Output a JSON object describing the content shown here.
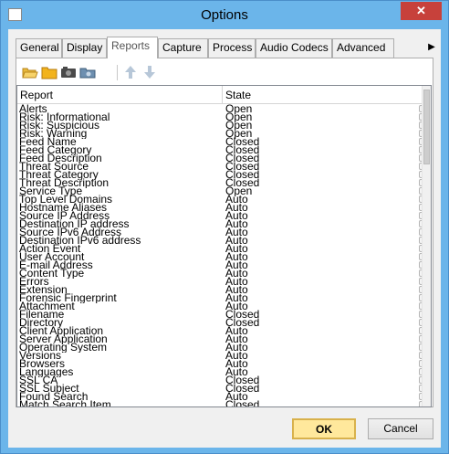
{
  "window": {
    "title": "Options",
    "close_label": "✕"
  },
  "tabs": [
    {
      "label": "General"
    },
    {
      "label": "Display"
    },
    {
      "label": "Reports"
    },
    {
      "label": "Capture"
    },
    {
      "label": "Process"
    },
    {
      "label": "Audio Codecs"
    },
    {
      "label": "Advanced"
    }
  ],
  "tab_scroll_icon": "▶",
  "toolbar": {
    "buttons": [
      "open-folder-icon",
      "folder-icon",
      "camera-icon",
      "camera-folder-icon",
      "arrow-up-icon",
      "arrow-down-icon"
    ]
  },
  "list": {
    "columns": [
      "Report",
      "State"
    ],
    "rows": [
      [
        "Alerts",
        "Open"
      ],
      [
        "Risk: Informational",
        "Open"
      ],
      [
        "Risk: Suspicious",
        "Open"
      ],
      [
        "Risk: Warning",
        "Open"
      ],
      [
        "Feed Name",
        "Closed"
      ],
      [
        "Feed Category",
        "Closed"
      ],
      [
        "Feed Description",
        "Closed"
      ],
      [
        "Threat Source",
        "Closed"
      ],
      [
        "Threat Category",
        "Closed"
      ],
      [
        "Threat Description",
        "Closed"
      ],
      [
        "Service Type",
        "Open"
      ],
      [
        "Top Level Domains",
        "Auto"
      ],
      [
        "Hostname Aliases",
        "Auto"
      ],
      [
        "Source IP Address",
        "Auto"
      ],
      [
        "Destination IP address",
        "Auto"
      ],
      [
        "Source IPv6 Address",
        "Auto"
      ],
      [
        "Destination IPv6 address",
        "Auto"
      ],
      [
        "Action Event",
        "Auto"
      ],
      [
        "User Account",
        "Auto"
      ],
      [
        "E-mail Address",
        "Auto"
      ],
      [
        "Content Type",
        "Auto"
      ],
      [
        "Errors",
        "Auto"
      ],
      [
        "Extension",
        "Auto"
      ],
      [
        "Forensic Fingerprint",
        "Auto"
      ],
      [
        "Attachment",
        "Auto"
      ],
      [
        "Filename",
        "Closed"
      ],
      [
        "Directory",
        "Closed"
      ],
      [
        "Client Application",
        "Auto"
      ],
      [
        "Server Application",
        "Auto"
      ],
      [
        "Operating System",
        "Auto"
      ],
      [
        "Versions",
        "Auto"
      ],
      [
        "Browsers",
        "Auto"
      ],
      [
        "Languages",
        "Auto"
      ],
      [
        "SSL CA",
        "Closed"
      ],
      [
        "SSL Subject",
        "Closed"
      ],
      [
        "Found Search",
        "Auto"
      ],
      [
        "Match Search Item",
        "Closed"
      ]
    ]
  },
  "buttons": {
    "ok": "OK",
    "cancel": "Cancel"
  }
}
